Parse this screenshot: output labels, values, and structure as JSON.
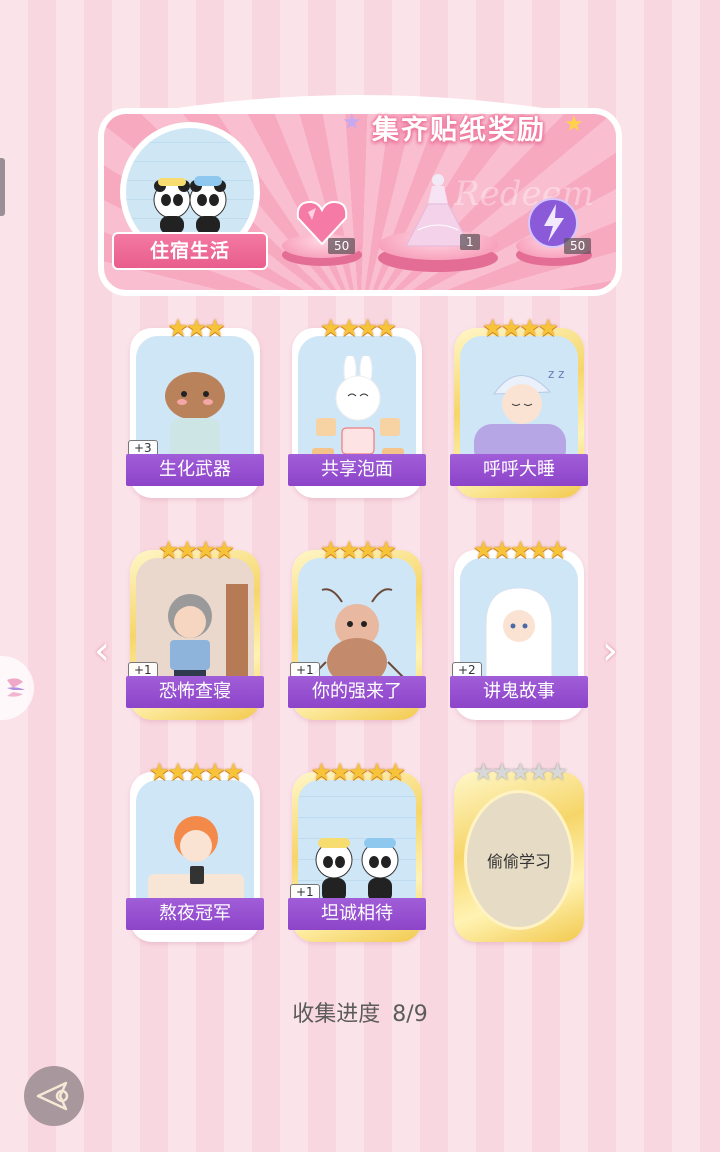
{
  "banner": {
    "title": "集齐贴纸奖励",
    "script_text": "Redeem",
    "dorm_label": "住宿生活",
    "rewards": [
      {
        "icon": "pink-heart-gem-icon",
        "count": "50"
      },
      {
        "icon": "dress-icon",
        "count": "1"
      },
      {
        "icon": "purple-lightning-orb-icon",
        "count": "50"
      }
    ]
  },
  "cards": [
    {
      "name": "生化武器",
      "stars": "★★★",
      "plus": "+3",
      "icon": "capybara-icon"
    },
    {
      "name": "共享泡面",
      "stars": "★★★★",
      "plus": "",
      "icon": "bunny-noodles-icon"
    },
    {
      "name": "呼呼大睡",
      "stars": "★★★★",
      "plus": "",
      "icon": "sleeping-boy-icon"
    },
    {
      "name": "恐怖查寝",
      "stars": "★★★★",
      "plus": "+1",
      "icon": "dorm-matron-icon"
    },
    {
      "name": "你的强来了",
      "stars": "★★★★",
      "plus": "+1",
      "icon": "cockroach-icon"
    },
    {
      "name": "讲鬼故事",
      "stars": "★★★★★",
      "plus": "+2",
      "icon": "ghost-icon"
    },
    {
      "name": "熬夜冠军",
      "stars": "★★★★★",
      "plus": "",
      "icon": "phone-in-bed-icon"
    },
    {
      "name": "坦诚相待",
      "stars": "★★★★★",
      "plus": "+1",
      "icon": "pandas-bath-icon"
    },
    {
      "name": "偷偷学习",
      "stars": "★★★★★",
      "plus": "",
      "icon": "locked-card-icon"
    }
  ],
  "progress": {
    "label": "收集进度",
    "value": "8/9"
  },
  "colors": {
    "pink": "#f8d7e0",
    "purple": "#9450cd",
    "gold": "#f7c338"
  }
}
